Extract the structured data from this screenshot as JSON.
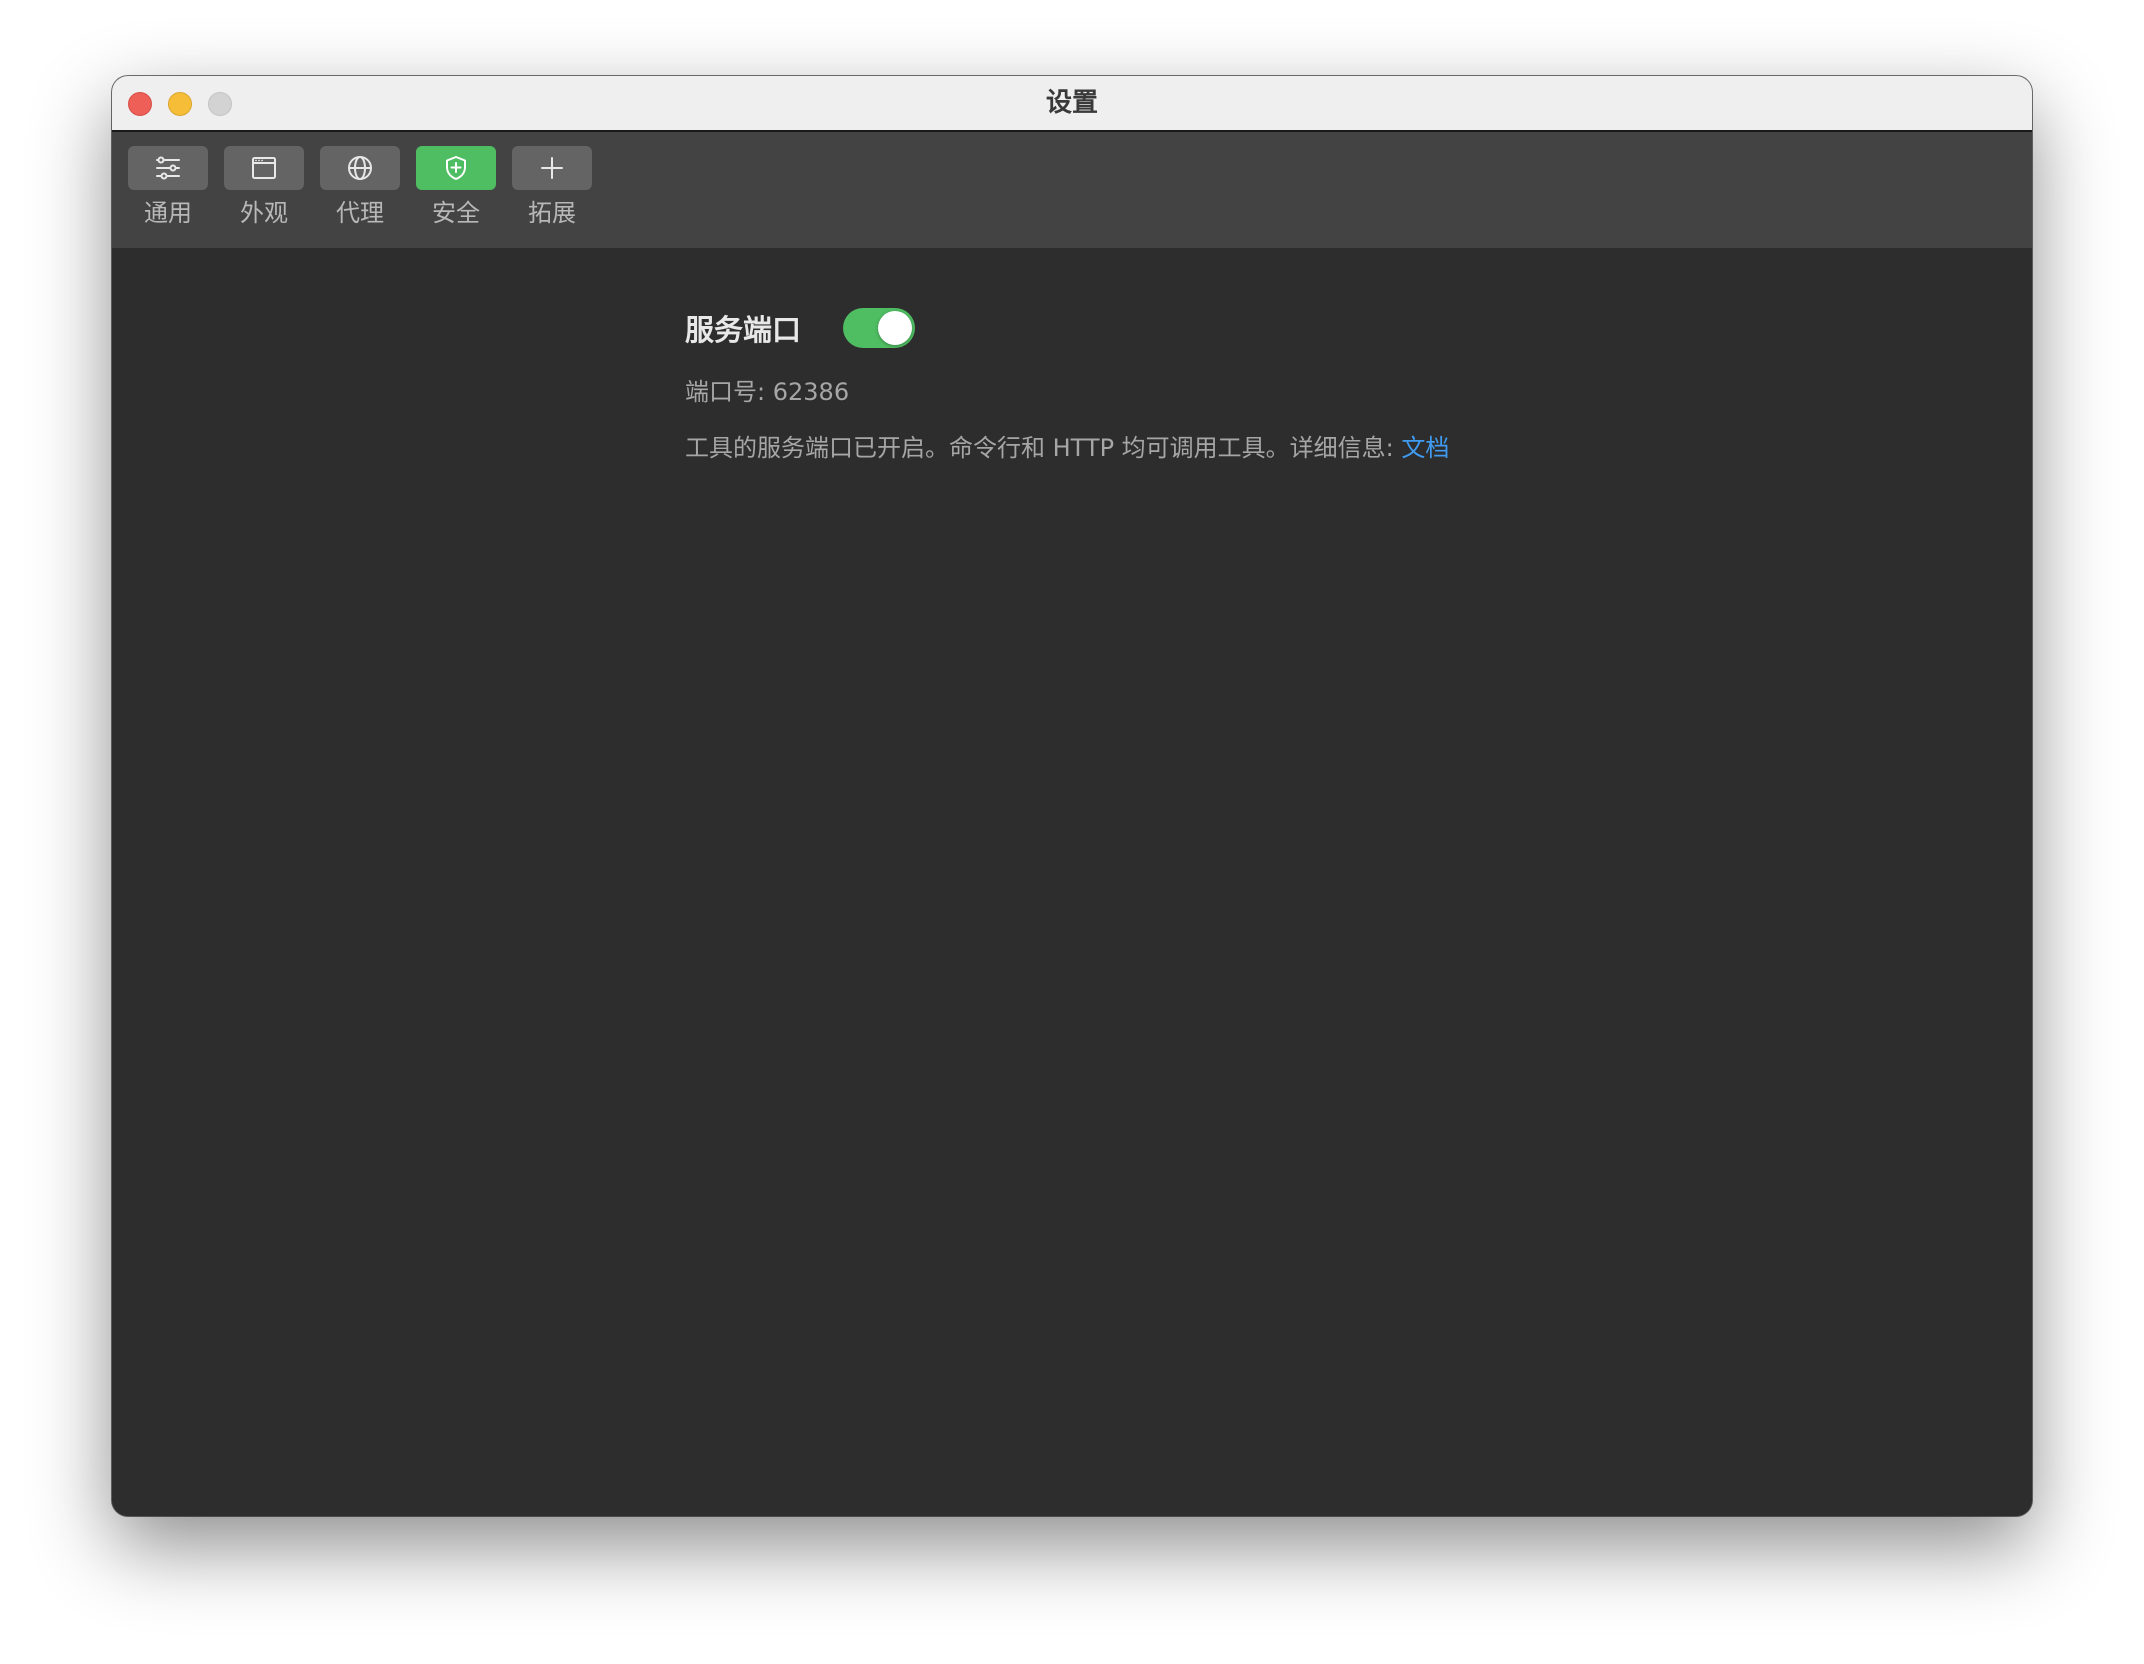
{
  "window": {
    "title": "设置"
  },
  "toolbar": {
    "items": [
      {
        "label": "通用",
        "icon": "sliders-icon",
        "active": false
      },
      {
        "label": "外观",
        "icon": "window-icon",
        "active": false
      },
      {
        "label": "代理",
        "icon": "globe-icon",
        "active": false
      },
      {
        "label": "安全",
        "icon": "shield-plus-icon",
        "active": true
      },
      {
        "label": "拓展",
        "icon": "plus-icon",
        "active": false
      }
    ]
  },
  "content": {
    "service_title": "服务端口",
    "service_enabled": true,
    "port_label": "端口号:",
    "port_value": "62386",
    "description": "工具的服务端口已开启。命令行和 HTTP 均可调用工具。详细信息:",
    "doc_link": "文档"
  },
  "colors": {
    "accent_green": "#4fbd62",
    "link_blue": "#3f9cf2",
    "background": "#2d2d2d",
    "toolbar": "#434343"
  }
}
